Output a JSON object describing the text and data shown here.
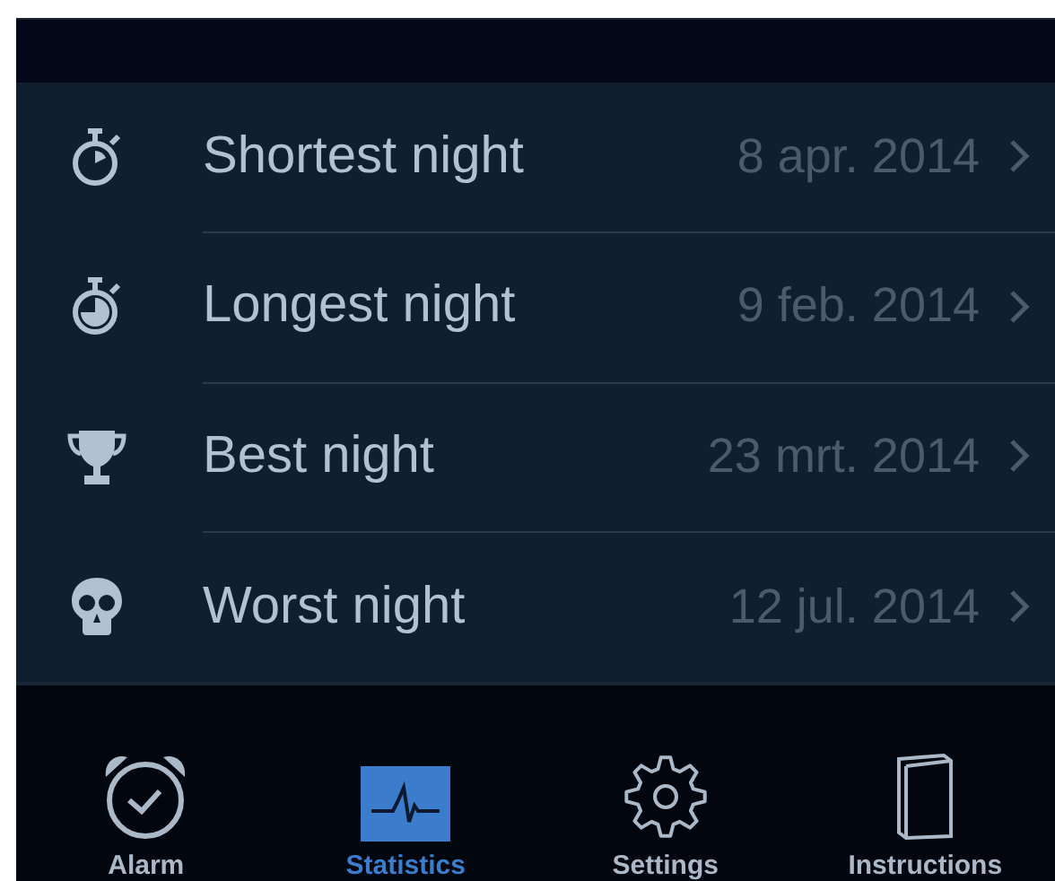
{
  "rows": [
    {
      "kind": "stopwatch-empty",
      "label": "Shortest night",
      "date": "8 apr. 2014"
    },
    {
      "kind": "stopwatch-full",
      "label": "Longest night",
      "date": "9 feb. 2014"
    },
    {
      "kind": "trophy",
      "label": "Best night",
      "date": "23 mrt. 2014"
    },
    {
      "kind": "skull",
      "label": "Worst night",
      "date": "12 jul. 2014"
    }
  ],
  "tabs": [
    {
      "kind": "alarm",
      "label": "Alarm",
      "selected": false
    },
    {
      "kind": "statistics",
      "label": "Statistics",
      "selected": true
    },
    {
      "kind": "settings",
      "label": "Settings",
      "selected": false
    },
    {
      "kind": "instructions",
      "label": "Instructions",
      "selected": false
    }
  ]
}
